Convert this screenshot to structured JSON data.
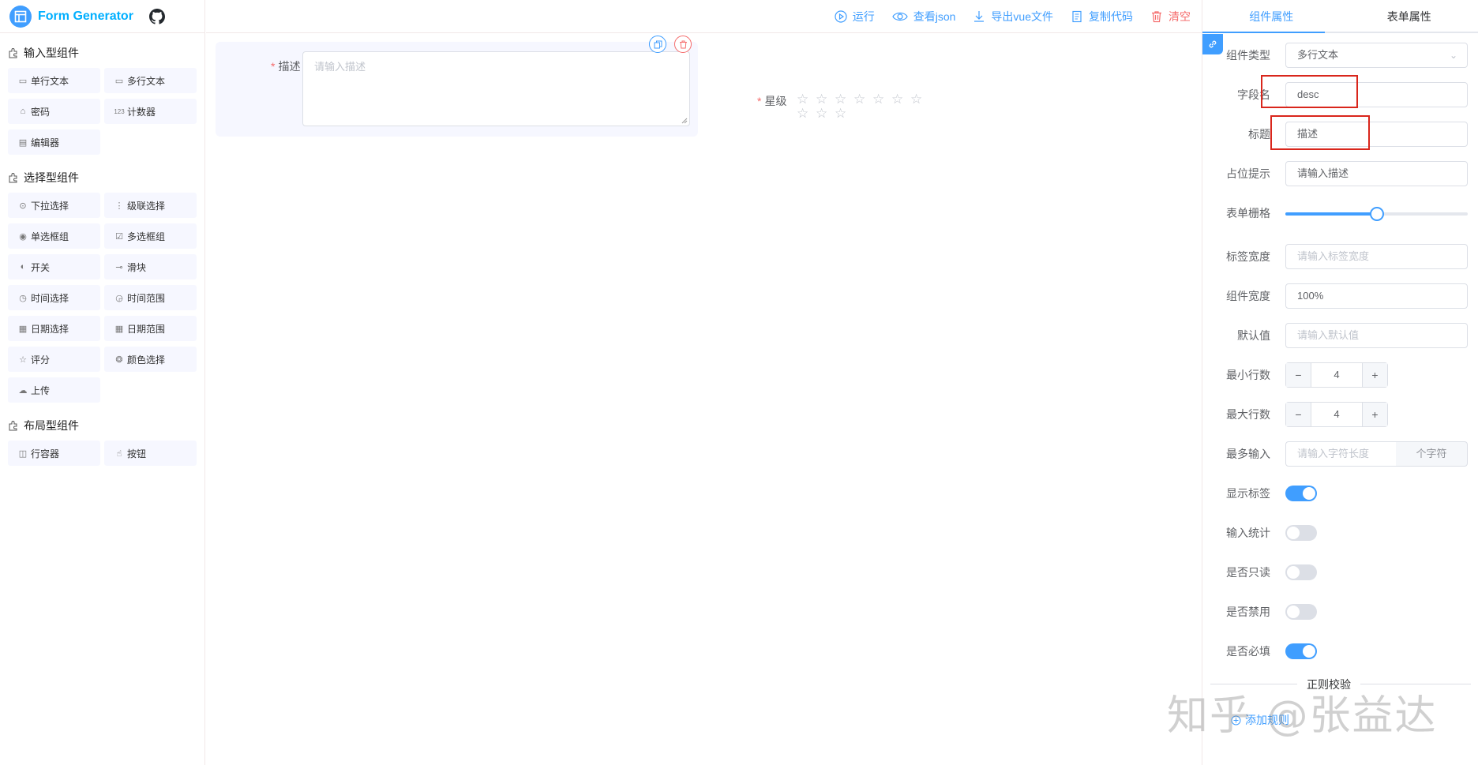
{
  "app": {
    "title": "Form Generator"
  },
  "left": {
    "groups": [
      {
        "title": "输入型组件",
        "items": [
          {
            "label": "单行文本",
            "icon": "input-icon"
          },
          {
            "label": "多行文本",
            "icon": "textarea-icon"
          },
          {
            "label": "密码",
            "icon": "lock-icon"
          },
          {
            "label": "计数器",
            "icon": "number-icon"
          },
          {
            "label": "编辑器",
            "icon": "editor-icon"
          }
        ]
      },
      {
        "title": "选择型组件",
        "items": [
          {
            "label": "下拉选择",
            "icon": "select-icon"
          },
          {
            "label": "级联选择",
            "icon": "cascader-icon"
          },
          {
            "label": "单选框组",
            "icon": "radio-icon"
          },
          {
            "label": "多选框组",
            "icon": "checkbox-icon"
          },
          {
            "label": "开关",
            "icon": "switch-icon"
          },
          {
            "label": "滑块",
            "icon": "slider-icon"
          },
          {
            "label": "时间选择",
            "icon": "clock-icon"
          },
          {
            "label": "时间范围",
            "icon": "time-range-icon"
          },
          {
            "label": "日期选择",
            "icon": "calendar-icon"
          },
          {
            "label": "日期范围",
            "icon": "date-range-icon"
          },
          {
            "label": "评分",
            "icon": "star-icon"
          },
          {
            "label": "颜色选择",
            "icon": "palette-icon"
          },
          {
            "label": "上传",
            "icon": "upload-icon"
          }
        ]
      },
      {
        "title": "布局型组件",
        "items": [
          {
            "label": "行容器",
            "icon": "row-icon"
          },
          {
            "label": "按钮",
            "icon": "pointer-icon"
          }
        ]
      }
    ]
  },
  "toolbar": {
    "run": "运行",
    "view_json": "查看json",
    "export_vue": "导出vue文件",
    "copy_code": "复制代码",
    "clear": "清空"
  },
  "canvas": {
    "field_desc": {
      "required_mark": "*",
      "label": "描述",
      "placeholder": "请输入描述"
    },
    "field_rate": {
      "required_mark": "*",
      "label": "星级",
      "stars": 10
    }
  },
  "right": {
    "tabs": [
      "组件属性",
      "表单属性"
    ],
    "props": {
      "type": {
        "label": "组件类型",
        "value": "多行文本"
      },
      "field": {
        "label": "字段名",
        "value": "desc"
      },
      "title": {
        "label": "标题",
        "value": "描述"
      },
      "placeholder": {
        "label": "占位提示",
        "value": "请输入描述"
      },
      "span": {
        "label": "表单栅格",
        "value_fraction": 0.5
      },
      "label_width": {
        "label": "标签宽度",
        "placeholder": "请输入标签宽度"
      },
      "width": {
        "label": "组件宽度",
        "value": "100%"
      },
      "default": {
        "label": "默认值",
        "placeholder": "请输入默认值"
      },
      "min_rows": {
        "label": "最小行数",
        "value": "4"
      },
      "max_rows": {
        "label": "最大行数",
        "value": "4"
      },
      "maxlength": {
        "label": "最多输入",
        "placeholder": "请输入字符长度",
        "append": "个字符"
      },
      "show_label": {
        "label": "显示标签",
        "on": true
      },
      "word_limit": {
        "label": "输入统计",
        "on": false
      },
      "readonly": {
        "label": "是否只读",
        "on": false
      },
      "disabled": {
        "label": "是否禁用",
        "on": false
      },
      "required": {
        "label": "是否必填",
        "on": true
      }
    },
    "regex_section": "正则校验",
    "add_rule": "添加规则"
  },
  "watermark": "知乎 @张益达",
  "colors": {
    "primary": "#409eff",
    "danger": "#f56c6c",
    "highlight": "#d9261c"
  }
}
